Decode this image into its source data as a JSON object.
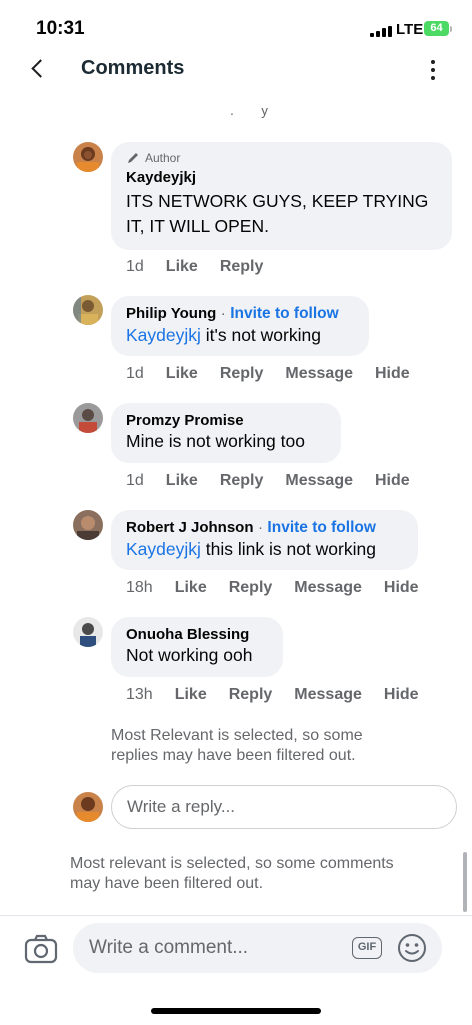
{
  "status": {
    "time": "10:31",
    "network": "LTE",
    "battery": "64"
  },
  "nav": {
    "title": "Comments"
  },
  "comments": [
    {
      "author_tag": "Author",
      "name": "Kaydeyjkj",
      "lines": [
        "ITS NETWORK GUYS, KEEP TRYING",
        "IT, IT WILL OPEN."
      ],
      "time": "1d",
      "like": "Like",
      "reply": "Reply"
    },
    {
      "name": "Philip Young",
      "invite": "Invite to follow",
      "mention": "Kaydeyjkj",
      "text": " it's not working",
      "time": "1d",
      "like": "Like",
      "reply": "Reply",
      "message": "Message",
      "hide": "Hide"
    },
    {
      "name": "Promzy Promise",
      "text": "Mine is not working too",
      "time": "1d",
      "like": "Like",
      "reply": "Reply",
      "message": "Message",
      "hide": "Hide"
    },
    {
      "name": "Robert J Johnson",
      "invite": "Invite to follow",
      "mention": "Kaydeyjkj",
      "text": " this link is not working",
      "time": "18h",
      "like": "Like",
      "reply": "Reply",
      "message": "Message",
      "hide": "Hide"
    },
    {
      "name": "Onuoha Blessing",
      "text": "Not working ooh",
      "time": "13h",
      "like": "Like",
      "reply": "Reply",
      "message": "Message",
      "hide": "Hide"
    }
  ],
  "replies_note": [
    "Most Relevant is selected, so some",
    "replies may have been filtered out."
  ],
  "reply_input": {
    "placeholder": "Write a reply..."
  },
  "comments_note": [
    "Most relevant is selected, so some comments",
    "may have been filtered out."
  ],
  "comment_input": {
    "placeholder": "Write a comment...",
    "gif_label": "GIF"
  },
  "colors": {
    "link": "#1b74e4",
    "bubble": "#f0f2f5",
    "meta": "#65676b"
  }
}
